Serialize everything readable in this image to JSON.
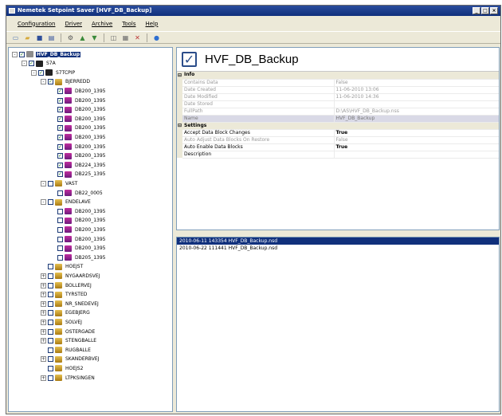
{
  "window": {
    "title": "Nemetek Setpoint Saver [HVF_DB_Backup]"
  },
  "window_buttons": [
    "_",
    "□",
    "×"
  ],
  "menu": [
    "Configuration",
    "Driver",
    "Archive",
    "Tools",
    "Help"
  ],
  "toolbar_icons": [
    "new-icon",
    "open-icon",
    "save-icon",
    "save-all-icon",
    "sep",
    "network-icon",
    "upload-icon",
    "download-icon",
    "sep",
    "compare-icon",
    "properties-icon",
    "delete-icon",
    "sep",
    "help-icon"
  ],
  "tree": [
    {
      "label": "HVF_DB_Backup",
      "level": 0,
      "expander": "-",
      "check": "✓",
      "icon": "gray",
      "selected": true
    },
    {
      "label": "S7A",
      "level": 1,
      "expander": "-",
      "check": "✓",
      "icon": "net"
    },
    {
      "label": "S7TCPIP",
      "level": 2,
      "expander": "-",
      "check": "✓",
      "icon": "net"
    },
    {
      "label": "BJERREDD",
      "level": 3,
      "expander": "-",
      "check": "✓",
      "icon": "folder"
    },
    {
      "label": "DB200_1395",
      "level": 4,
      "check": "✓",
      "icon": "db"
    },
    {
      "label": "DB200_1395",
      "level": 4,
      "check": "✓",
      "icon": "db"
    },
    {
      "label": "DB200_1395",
      "level": 4,
      "check": "✓",
      "icon": "db"
    },
    {
      "label": "DB200_1395",
      "level": 4,
      "check": "✓",
      "icon": "db"
    },
    {
      "label": "DB200_1395",
      "level": 4,
      "check": "✓",
      "icon": "db"
    },
    {
      "label": "DB200_1395",
      "level": 4,
      "check": "✓",
      "icon": "db"
    },
    {
      "label": "DB200_1395",
      "level": 4,
      "check": "✓",
      "icon": "db"
    },
    {
      "label": "DB200_1395",
      "level": 4,
      "check": "✓",
      "icon": "db"
    },
    {
      "label": "DB224_1395",
      "level": 4,
      "check": "✓",
      "icon": "db"
    },
    {
      "label": "DB225_1395",
      "level": 4,
      "check": "✓",
      "icon": "db"
    },
    {
      "label": "VAST",
      "level": 3,
      "expander": "-",
      "check": "",
      "icon": "folder"
    },
    {
      "label": "DB22_0005",
      "level": 4,
      "check": "",
      "icon": "db"
    },
    {
      "label": "ENDELAVE",
      "level": 3,
      "expander": "-",
      "check": "",
      "icon": "folder"
    },
    {
      "label": "DB200_1395",
      "level": 4,
      "check": "",
      "icon": "db"
    },
    {
      "label": "DB200_1395",
      "level": 4,
      "check": "",
      "icon": "db"
    },
    {
      "label": "DB200_1395",
      "level": 4,
      "check": "",
      "icon": "db"
    },
    {
      "label": "DB200_1395",
      "level": 4,
      "check": "",
      "icon": "db"
    },
    {
      "label": "DB200_1395",
      "level": 4,
      "check": "",
      "icon": "db"
    },
    {
      "label": "DB205_1395",
      "level": 4,
      "check": "",
      "icon": "db"
    },
    {
      "label": "HOEJST",
      "level": 3,
      "expander": "",
      "check": "",
      "icon": "folder"
    },
    {
      "label": "NYGAARDSVEJ",
      "level": 3,
      "expander": "+",
      "check": "",
      "icon": "folder"
    },
    {
      "label": "BOLLERVEJ",
      "level": 3,
      "expander": "+",
      "check": "",
      "icon": "folder"
    },
    {
      "label": "TYRSTED",
      "level": 3,
      "expander": "+",
      "check": "",
      "icon": "folder"
    },
    {
      "label": "NR_SNEDEVEJ",
      "level": 3,
      "expander": "+",
      "check": "",
      "icon": "folder"
    },
    {
      "label": "EGEBJERG",
      "level": 3,
      "expander": "+",
      "check": "",
      "icon": "folder"
    },
    {
      "label": "SOLVEJ",
      "level": 3,
      "expander": "+",
      "check": "",
      "icon": "folder"
    },
    {
      "label": "OSTERGADE",
      "level": 3,
      "expander": "+",
      "check": "",
      "icon": "folder"
    },
    {
      "label": "STENGBALLE",
      "level": 3,
      "expander": "+",
      "check": "",
      "icon": "folder"
    },
    {
      "label": "RUGBALLE",
      "level": 3,
      "expander": "",
      "check": "",
      "icon": "folder"
    },
    {
      "label": "SKANDERBVEJ",
      "level": 3,
      "expander": "+",
      "check": "",
      "icon": "folder"
    },
    {
      "label": "HOEJS2",
      "level": 3,
      "expander": "",
      "check": "",
      "icon": "folder"
    },
    {
      "label": "LTPKSINGEN",
      "level": 3,
      "expander": "+",
      "check": "",
      "icon": "folder"
    }
  ],
  "details": {
    "title": "HVF_DB_Backup",
    "categories": [
      {
        "label": "Info",
        "rows": [
          {
            "name": "Contains Data",
            "value": "False",
            "readonly": true
          },
          {
            "name": "Date Created",
            "value": "11-06-2010 13:06",
            "readonly": true
          },
          {
            "name": "Date Modified",
            "value": "11-06-2010 14:36",
            "readonly": true
          },
          {
            "name": "Date Stored",
            "value": "",
            "readonly": true
          },
          {
            "name": "FullPath",
            "value": "D:\\AS\\HVF_DB_Backup.nss",
            "readonly": true
          },
          {
            "name": "Name",
            "value": "HVF_DB_Backup",
            "readonly": true,
            "selected": true
          }
        ]
      },
      {
        "label": "Settings",
        "rows": [
          {
            "name": "Accept Data Block Changes",
            "value": "True",
            "readonly": false
          },
          {
            "name": "Auto Adjust Data Blocks On Restore",
            "value": "False",
            "readonly": true
          },
          {
            "name": "Auto Enable Data Blocks",
            "value": "True",
            "readonly": false
          },
          {
            "name": "Description",
            "value": "",
            "readonly": false
          }
        ]
      }
    ]
  },
  "files": [
    {
      "name": "2010-06-11 143354 HVF_DB_Backup.nsd",
      "selected": true
    },
    {
      "name": "2010-06-22 111441 HVF_DB_Backup.nsd",
      "selected": false
    }
  ]
}
